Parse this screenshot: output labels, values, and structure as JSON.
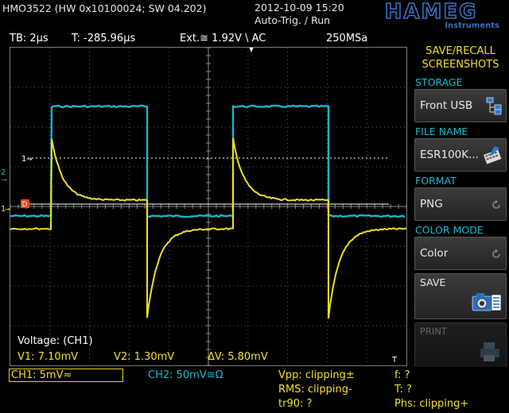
{
  "header": {
    "model_info": "HMO3522 (HW 0x10100024; SW 04.202)",
    "datetime": "2012-10-09 15:20",
    "trigger_state": "Auto-Trig. / Run",
    "brand": "HAMEG",
    "brand_sub": "Instruments"
  },
  "status": {
    "timebase": "TB: 2µs",
    "trigger_time": "T: -285.96µs",
    "trigger_info": "Ext.≅ 1.92V \\ AC",
    "sample_rate": "250MSa"
  },
  "markers": {
    "cursor1": "1",
    "ch2": "2",
    "ch1": "1",
    "ref": "D",
    "trig": "T"
  },
  "measurements": {
    "title": "Voltage: (CH1)",
    "v1": "V1: 7.10mV",
    "v2": "V2: 1.30mV",
    "dv": "ΔV: 5.80mV"
  },
  "menu": {
    "title_line1": "SAVE/RECALL",
    "title_line2": "SCREENSHOTS",
    "storage_title": "STORAGE",
    "storage_value": "Front USB",
    "filename_title": "FILE NAME",
    "filename_value": "ESR100K...",
    "format_title": "FORMAT",
    "format_value": "PNG",
    "colormode_title": "COLOR MODE",
    "colormode_value": "Color",
    "save_label": "SAVE",
    "print_label": "PRINT"
  },
  "bottom": {
    "ch1": "CH1: 5mV≈",
    "ch2": "CH2: 50mV≅Ω",
    "vpp": "Vpp: clipping±",
    "rms": "RMS: clipping-",
    "tr90": "tr90: ?",
    "freq": "f: ?",
    "period": "T: ?",
    "phase": "Phs: clipping+"
  },
  "colors": {
    "ch1_trace": "#f0e020",
    "ch2_trace": "#18b4cc",
    "menu_title": "#f2e020",
    "section_title": "#1ab8d4",
    "grid": "#5a5a5a"
  }
}
